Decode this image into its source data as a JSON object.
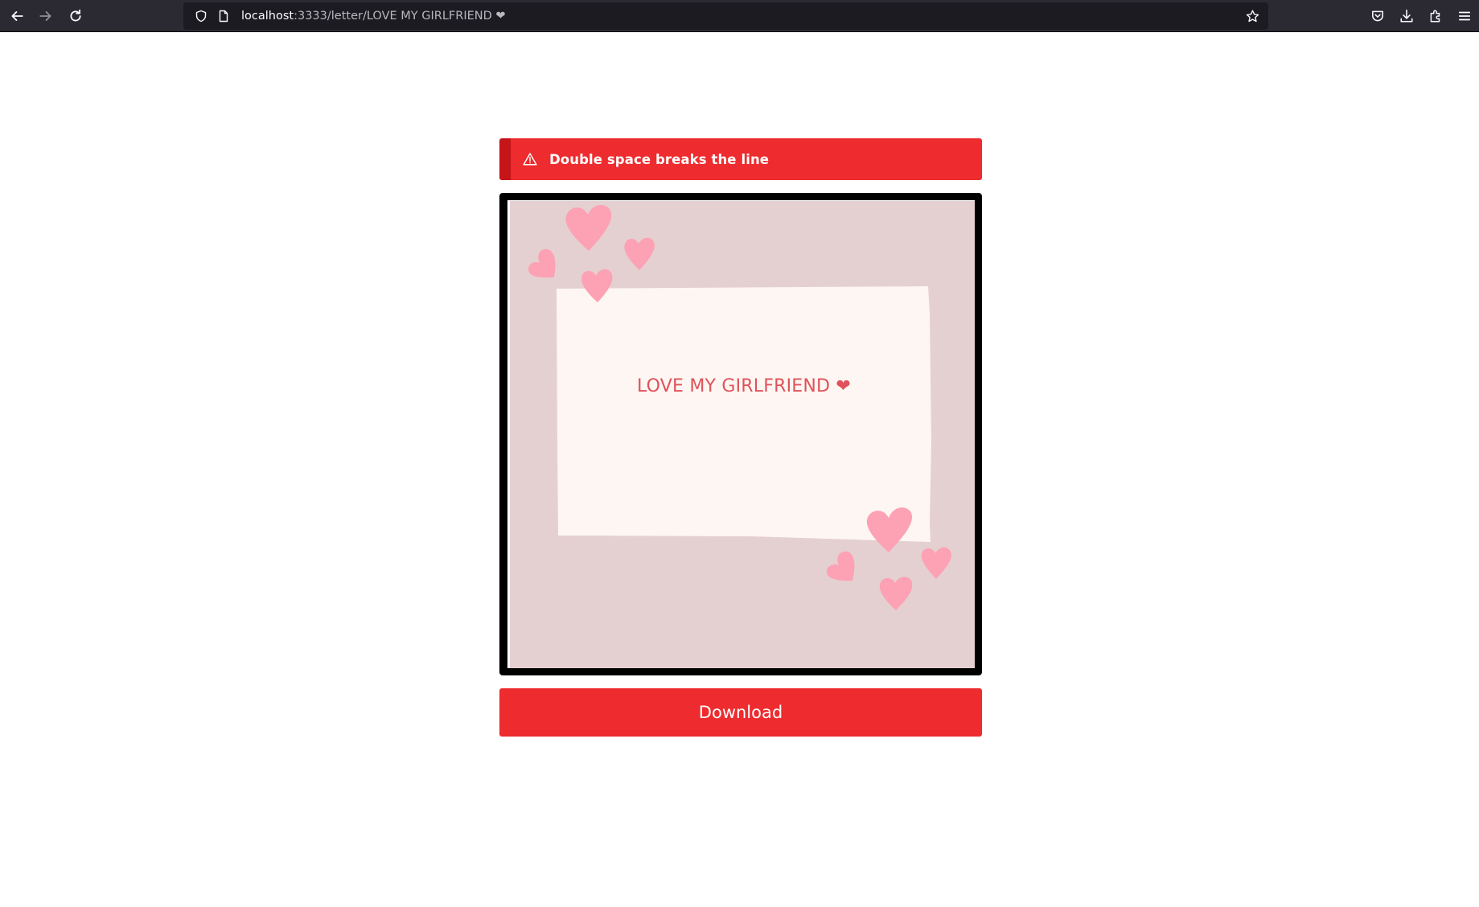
{
  "browser": {
    "url_host": "localhost",
    "url_path": ":3333/letter/LOVE MY GIRLFRIEND ❤",
    "icons": {
      "back": "back-arrow-icon",
      "forward": "forward-arrow-icon",
      "reload": "reload-icon",
      "tracking": "shield-icon",
      "page": "page-icon",
      "bookmark": "star-icon",
      "pocket": "pocket-icon",
      "downloads": "download-icon",
      "extensions": "extensions-icon",
      "menu": "hamburger-menu-icon"
    }
  },
  "alert": {
    "text": "Double space breaks the line",
    "icon": "warning-icon",
    "color": "#ee2b2e",
    "accent": "#c51519"
  },
  "card": {
    "text": "LOVE MY GIRLFRIEND ❤",
    "background": "#e5d0d1",
    "paper": "#fdf6f2",
    "heart_color": "#fda1b4",
    "text_color": "#e0525b"
  },
  "download": {
    "label": "Download"
  }
}
